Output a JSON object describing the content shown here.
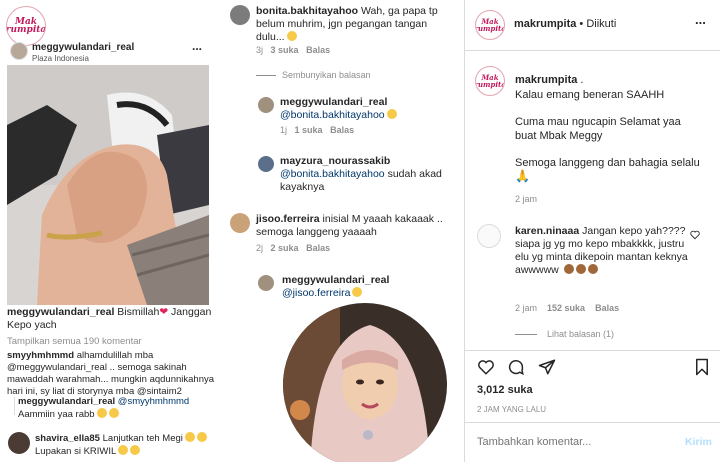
{
  "brand": {
    "logo_line1": "Mak",
    "logo_line2": "rumpita"
  },
  "left_post": {
    "username": "meggywulandari_real",
    "location": "Plaza Indonesia",
    "more": "...",
    "caption_user": "meggywulandari_real",
    "caption_text": "Bismillah",
    "caption_text2": "Janggan Kepo yach",
    "view_all": "Tampilkan semua 190 komentar",
    "comments": [
      {
        "user": "smyyhmhmmd",
        "text": "alhamdulillah mba @meggywulandari_real .. semoga sakinah mawaddah warahmah... mungkin aqdunnikahnya hari ini, sy liat di storynya mba @sintaim2"
      },
      {
        "user": "meggywulandari_real",
        "mention": "@smyyhmhmmd",
        "text": "Aammiin yaa rabb"
      },
      {
        "user": "shavira_ella85",
        "text": "Lanjutkan teh Megi",
        "text2": "Lupakan si KRIWIL"
      }
    ]
  },
  "middle": {
    "c1": {
      "user": "bonita.bakhitayahoo",
      "text": "Wah, ga papa tp belum muhrim, jgn pegangan tangan dulu...",
      "time": "3j",
      "likes": "3 suka",
      "reply": "Balas"
    },
    "hide_replies": "Sembunyikan balasan",
    "c2": {
      "user": "meggywulandari_real",
      "mention": "@bonita.bakhitayahoo",
      "time": "1j",
      "likes": "1 suka",
      "reply": "Balas"
    },
    "c3": {
      "user": "mayzura_nourassakib",
      "mention": "@bonita.bakhitayahoo",
      "text": "sudah akad kayaknya"
    },
    "c4": {
      "user": "jisoo.ferreira",
      "text": "inisial M yaaah kakaaak .. semoga langgeng yaaaah",
      "time": "2j",
      "likes": "2 suka",
      "reply": "Balas"
    },
    "c5": {
      "user": "meggywulandari_real",
      "mention": "@jisoo.ferreira"
    }
  },
  "right": {
    "header_user": "makrumpita",
    "header_sep": "•",
    "header_follow": "Diikuti",
    "more": "...",
    "caption_user": "makrumpita",
    "caption_dot": ".",
    "caption_lines": [
      "Kalau emang beneran SAAHH",
      "Cuma mau ngucapin Selamat yaa",
      "buat Mbak Meggy",
      "Semoga langgeng dan bahagia selalu"
    ],
    "caption_time": "2 jam",
    "comment": {
      "user": "karen.ninaaa",
      "text": "Jangan kepo yah???? siapa jg yg mo kepo mbakkkk, justru elu yg minta dikepoin mantan keknya awwwww",
      "time": "2 jam",
      "likes": "152 suka",
      "reply": "Balas",
      "view_replies": "Lihat balasan (1)"
    },
    "likes": "3,012 suka",
    "post_time": "2 JAM YANG LALU",
    "add_comment_placeholder": "Tambahkan komentar...",
    "send_label": "Kirim"
  }
}
